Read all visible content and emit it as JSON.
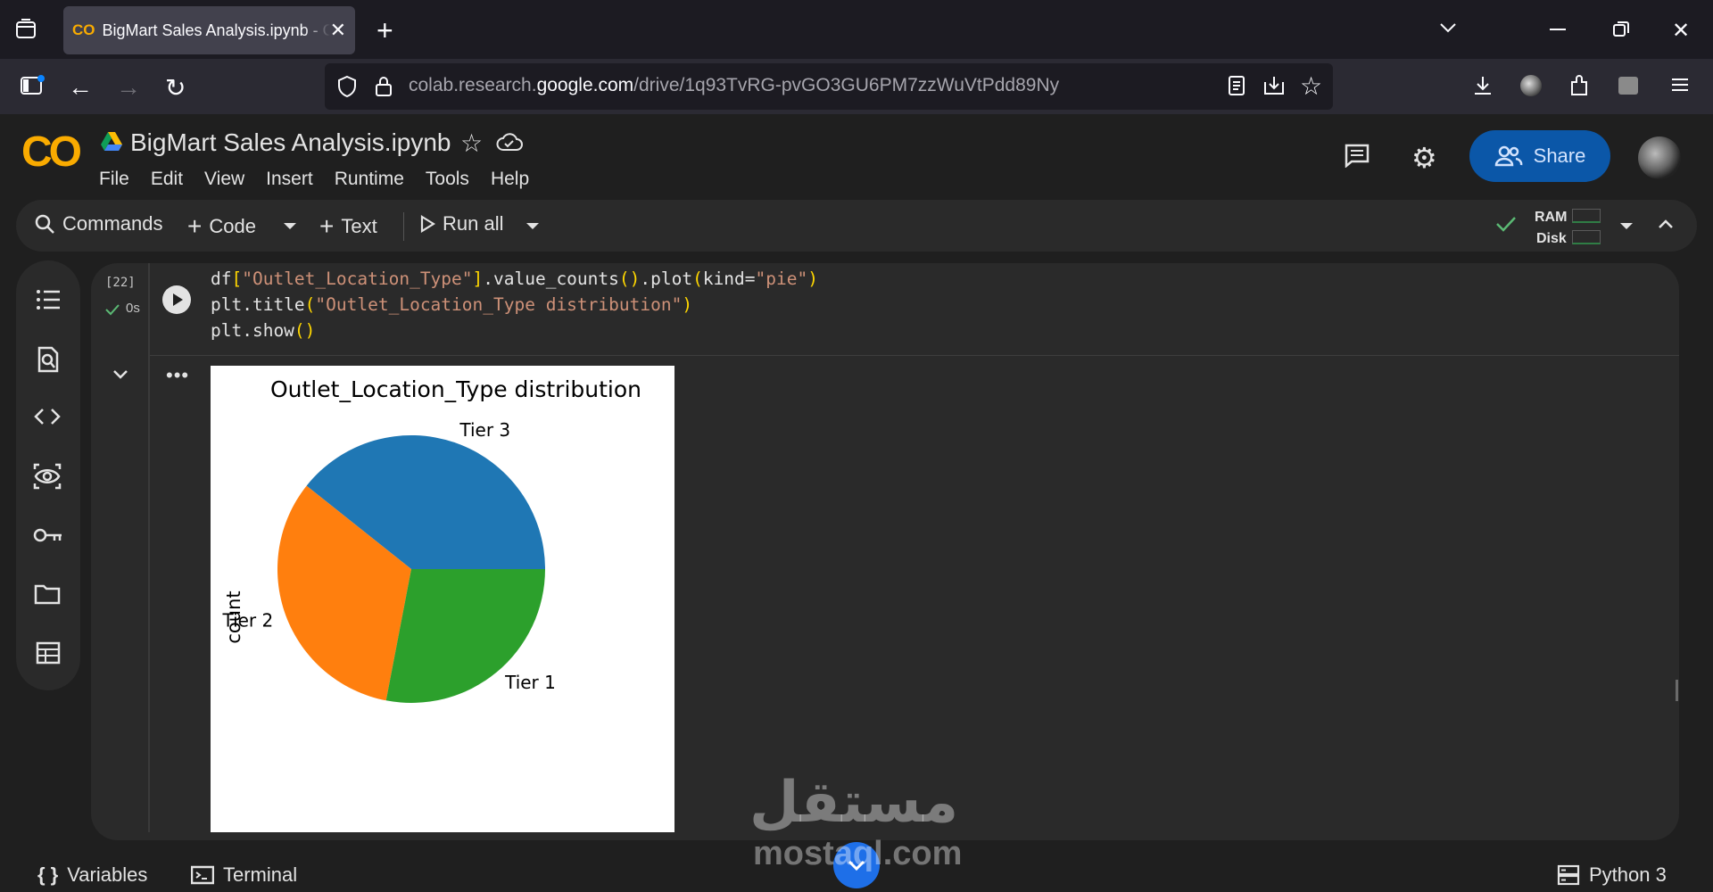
{
  "browser": {
    "tab_title": "BigMart Sales Analysis.ipynb - Colab",
    "url_prefix": "colab.research.",
    "url_host": "google.com",
    "url_path": "/drive/1q93TvRG-pvGO3GU6PM7zzWuVtPdd89Ny"
  },
  "colab": {
    "logo_text": "CO",
    "notebook_title": "BigMart Sales Analysis.ipynb",
    "menu": [
      "File",
      "Edit",
      "View",
      "Insert",
      "Runtime",
      "Tools",
      "Help"
    ],
    "share_label": "Share"
  },
  "toolbar": {
    "commands_label": "Commands",
    "code_label": "Code",
    "text_label": "Text",
    "run_all_label": "Run all",
    "ram_label": "RAM",
    "disk_label": "Disk"
  },
  "cell": {
    "execution_count": "[22]",
    "exec_time": "0s",
    "code_lines": [
      {
        "a": "df",
        "b": "[",
        "c": "\"Outlet_Location_Type\"",
        "d": "]",
        "e": ".value_counts",
        "f": "()",
        "g": ".plot",
        "h": "(",
        "i": "kind=",
        "j": "\"pie\"",
        "k": ")"
      },
      {
        "a": "plt.title",
        "b": "(",
        "c": "\"Outlet_Location_Type distribution\"",
        "d": ")"
      },
      {
        "a": "plt.show",
        "b": "()"
      }
    ]
  },
  "chart_data": {
    "type": "pie",
    "title": "Outlet_Location_Type distribution",
    "ylabel": "count",
    "categories": [
      "Tier 3",
      "Tier 2",
      "Tier 1"
    ],
    "values": [
      3350,
      2785,
      2388
    ],
    "colors": [
      "#1f77b4",
      "#ff7f0e",
      "#2ca02c"
    ]
  },
  "statusbar": {
    "variables_label": "Variables",
    "terminal_label": "Terminal",
    "runtime_label": "Python 3"
  },
  "watermark": {
    "arabic": "مستقل",
    "latin": "mostaql.com"
  }
}
